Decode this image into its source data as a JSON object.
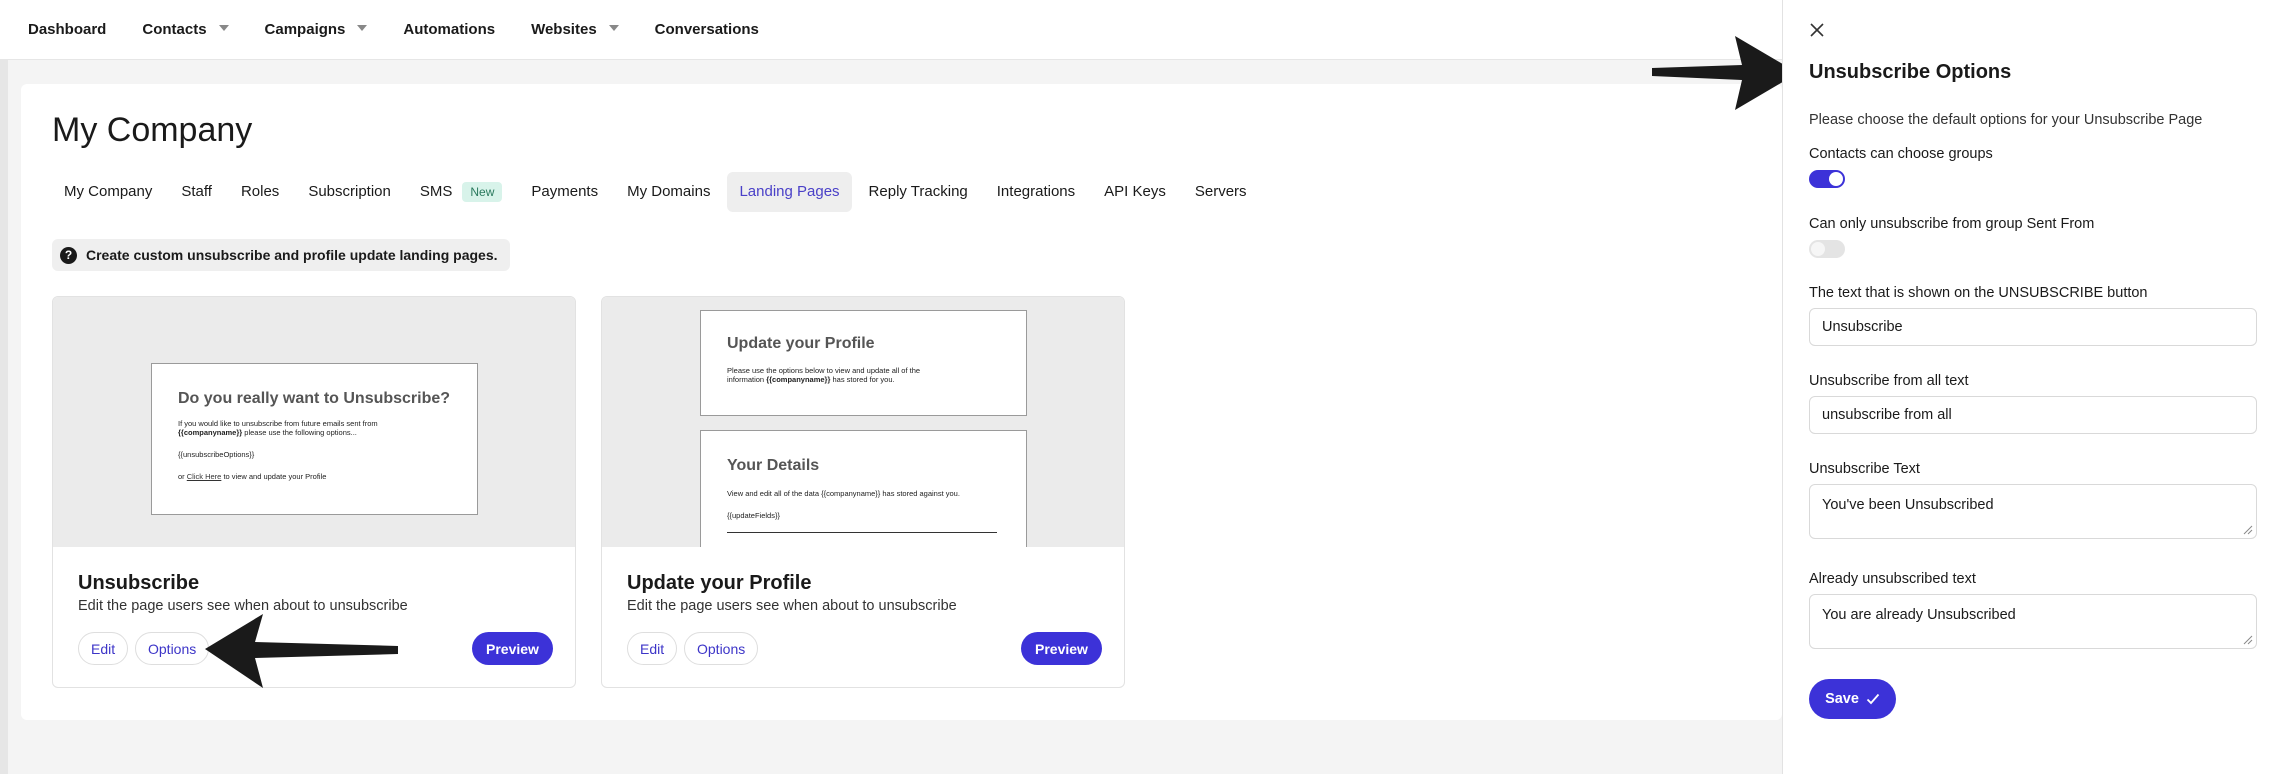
{
  "topnav": {
    "items": [
      {
        "label": "Dashboard",
        "caret": false
      },
      {
        "label": "Contacts",
        "caret": true
      },
      {
        "label": "Campaigns",
        "caret": true
      },
      {
        "label": "Automations",
        "caret": false
      },
      {
        "label": "Websites",
        "caret": true
      },
      {
        "label": "Conversations",
        "caret": false
      }
    ]
  },
  "page": {
    "title": "My Company",
    "tabs": [
      {
        "label": "My Company"
      },
      {
        "label": "Staff"
      },
      {
        "label": "Roles"
      },
      {
        "label": "Subscription"
      },
      {
        "label": "SMS",
        "badge": "New"
      },
      {
        "label": "Payments"
      },
      {
        "label": "My Domains"
      },
      {
        "label": "Landing Pages",
        "active": true
      },
      {
        "label": "Reply Tracking"
      },
      {
        "label": "Integrations"
      },
      {
        "label": "API Keys"
      },
      {
        "label": "Servers"
      }
    ],
    "info": "Create custom unsubscribe and profile update landing pages."
  },
  "cards": [
    {
      "title": "Unsubscribe",
      "desc": "Edit the page users see when about to unsubscribe",
      "edit": "Edit",
      "options": "Options",
      "preview": "Preview",
      "mock": {
        "heading": "Do you really want to Unsubscribe?",
        "line1": "If you would like to unsubscribe from future emails sent from",
        "line2_bold": "{{companyname}}",
        "line2_rest": " please use the following options...",
        "tag": "{{unsubscribeOptions}}",
        "foot_pre": "or ",
        "foot_link": "Click Here",
        "foot_post": " to view and update your Profile"
      }
    },
    {
      "title": "Update your Profile",
      "desc": "Edit the page users see when about to unsubscribe",
      "edit": "Edit",
      "options": "Options",
      "preview": "Preview",
      "mock": {
        "heading1": "Update your Profile",
        "p1a": "Please use the options below to view and update all of the",
        "p1b_pre": "information ",
        "p1b_bold": "{{companyname}}",
        "p1b_post": " has stored for you.",
        "heading2": "Your Details",
        "p2": "View and edit all of the data {{companyname}} has stored against you.",
        "tag": "{{updateFields}}"
      }
    }
  ],
  "panel": {
    "title": "Unsubscribe Options",
    "desc": "Please choose the default options for your Unsubscribe Page",
    "groups_label": "Contacts can choose groups",
    "groups_on": true,
    "sentfrom_label": "Can only unsubscribe from group Sent From",
    "sentfrom_on": false,
    "button_text_label": "The text that is shown on the UNSUBSCRIBE button",
    "button_text_value": "Unsubscribe",
    "all_text_label": "Unsubscribe from all text",
    "all_text_value": "unsubscribe from all",
    "unsub_text_label": "Unsubscribe Text",
    "unsub_text_value": "You've been Unsubscribed",
    "already_label": "Already unsubscribed text",
    "already_value": "You are already Unsubscribed",
    "save": "Save"
  },
  "colors": {
    "accent": "#3c32d8",
    "active_tab_text": "#4a40c8",
    "badge_bg": "#d8f3ea"
  }
}
